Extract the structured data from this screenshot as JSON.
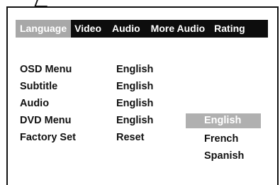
{
  "tabs": [
    {
      "label": "Language",
      "active": true
    },
    {
      "label": "Video",
      "active": false
    },
    {
      "label": "Audio",
      "active": false
    },
    {
      "label": "More Audio",
      "active": false
    },
    {
      "label": "Rating",
      "active": false
    }
  ],
  "settings": [
    {
      "label": "OSD Menu",
      "value": "English"
    },
    {
      "label": "Subtitle",
      "value": "English"
    },
    {
      "label": "Audio",
      "value": "English"
    },
    {
      "label": "DVD Menu",
      "value": "English"
    },
    {
      "label": "Factory Set",
      "value": "Reset"
    }
  ],
  "dropdown": {
    "options": [
      "English",
      "French",
      "Spanish"
    ],
    "selected": "English"
  },
  "colors": {
    "tab_bar": "#0d0d0d",
    "active_tab": "#a8a8a8",
    "selected_option": "#b0b0b0"
  }
}
